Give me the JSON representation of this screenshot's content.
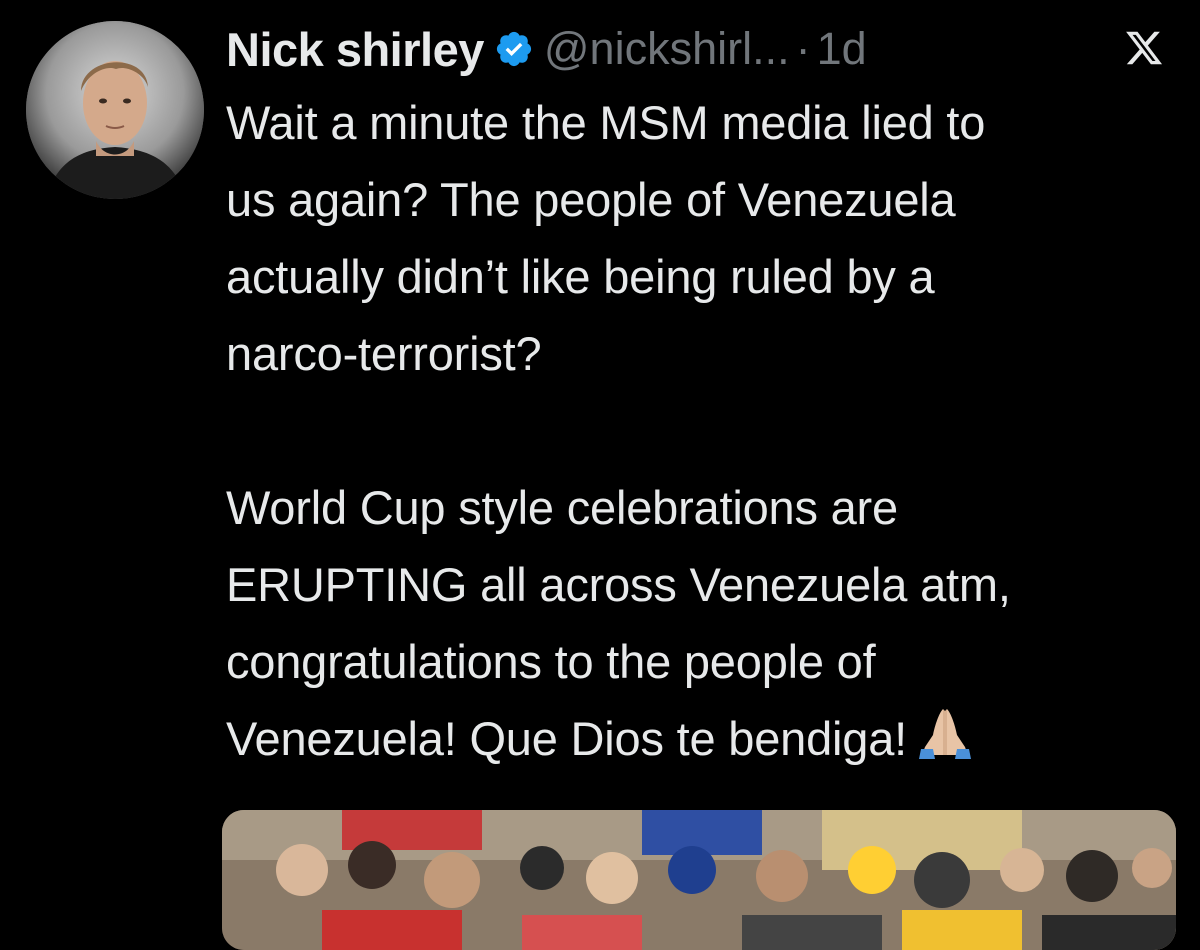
{
  "tweet": {
    "author": {
      "display_name": "Nick shirley",
      "handle": "@nickshirl...",
      "verified": true,
      "avatar_icon": "profile-photo"
    },
    "separator": "·",
    "timestamp": "1d",
    "paragraph_1": [
      "Wait a minute the MSM media lied to",
      "us again? The people of Venezuela",
      "actually didn’t like being ruled by a",
      "narco-terrorist?"
    ],
    "paragraph_2": [
      "World Cup style celebrations are",
      "ERUPTING all across Venezuela atm,",
      "congratulations to the people of",
      "Venezuela! Que Dios te bendiga!"
    ],
    "emoji": "folded-hands",
    "media": {
      "type": "video-thumbnail",
      "description_icon": "crowd-photo"
    }
  },
  "app": {
    "logo": "x-logo"
  },
  "colors": {
    "background": "#000000",
    "text": "#e7e9ea",
    "muted": "#71767b",
    "verified_blue": "#1d9bf0"
  }
}
